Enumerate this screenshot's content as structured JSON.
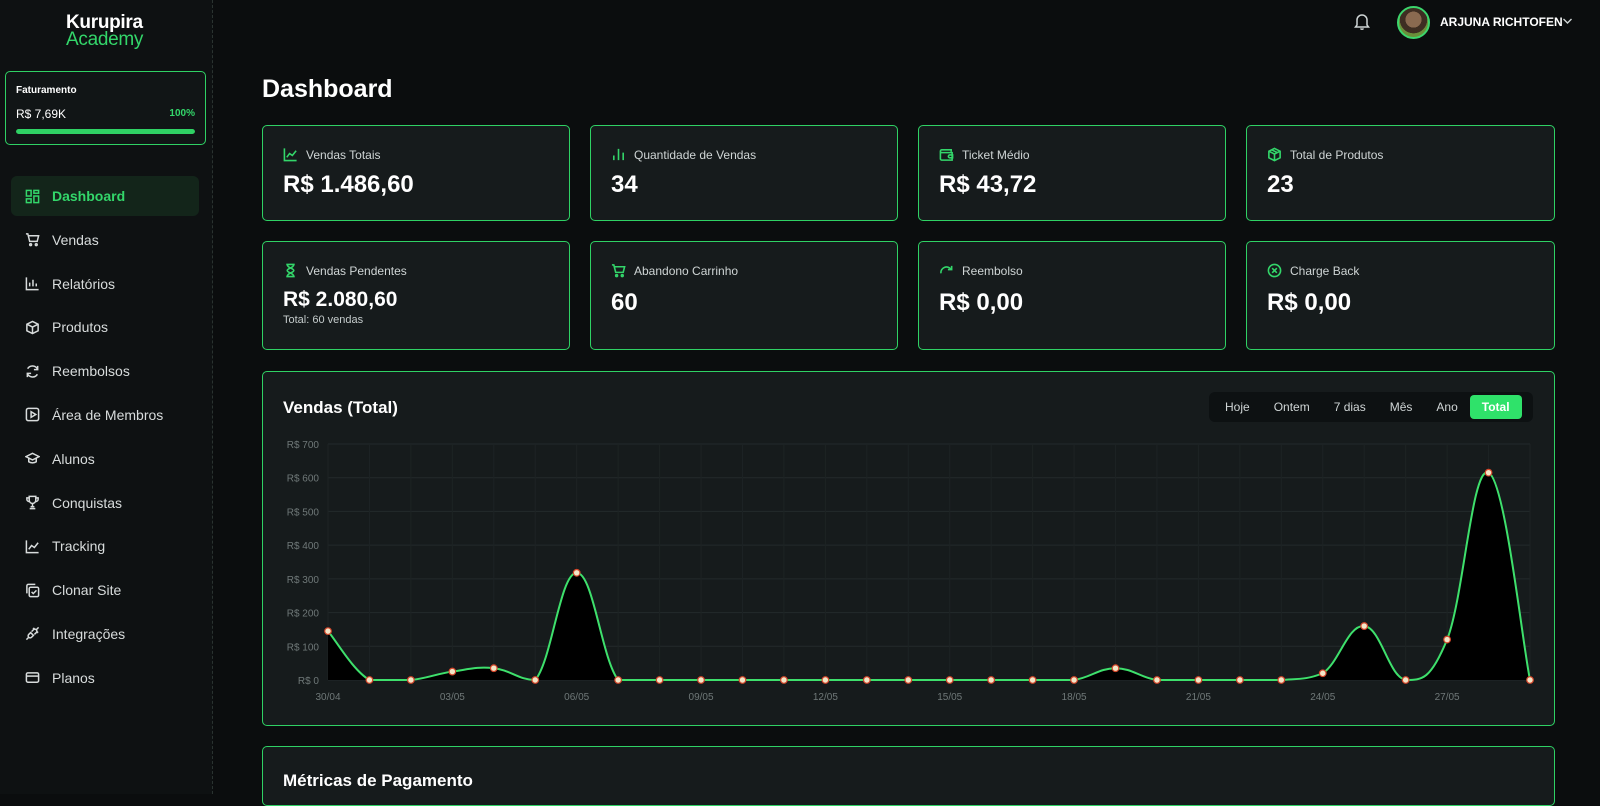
{
  "brand": {
    "line1": "Kurupira",
    "line2": "Academy"
  },
  "faturamento": {
    "title": "Faturamento",
    "value": "R$ 7,69K",
    "percent_label": "100%",
    "progress": 1.0
  },
  "sidebar": {
    "items": [
      {
        "label": "Dashboard",
        "icon": "dashboard-icon",
        "active": true
      },
      {
        "label": "Vendas",
        "icon": "cart-icon"
      },
      {
        "label": "Relatórios",
        "icon": "bar-chart-icon"
      },
      {
        "label": "Produtos",
        "icon": "box-icon"
      },
      {
        "label": "Reembolsos",
        "icon": "refresh-icon"
      },
      {
        "label": "Área de Membros",
        "icon": "play-square-icon"
      },
      {
        "label": "Alunos",
        "icon": "graduation-cap-icon"
      },
      {
        "label": "Conquistas",
        "icon": "trophy-icon"
      },
      {
        "label": "Tracking",
        "icon": "line-chart-icon"
      },
      {
        "label": "Clonar Site",
        "icon": "copy-check-icon"
      },
      {
        "label": "Integrações",
        "icon": "plug-icon"
      },
      {
        "label": "Planos",
        "icon": "credit-card-icon"
      }
    ]
  },
  "header": {
    "user_name": "ARJUNA RICHTOFEN",
    "notification_icon": "bell-icon"
  },
  "page": {
    "title": "Dashboard"
  },
  "stats": [
    {
      "label": "Vendas Totais",
      "value": "R$ 1.486,60",
      "icon": "trend-icon"
    },
    {
      "label": "Quantidade de Vendas",
      "value": "34",
      "icon": "bars-icon"
    },
    {
      "label": "Ticket Médio",
      "value": "R$ 43,72",
      "icon": "wallet-icon"
    },
    {
      "label": "Total de Produtos",
      "value": "23",
      "icon": "package-icon"
    },
    {
      "label": "Vendas Pendentes",
      "value": "R$ 2.080,60",
      "sub": "Total: 60 vendas",
      "icon": "hourglass-icon"
    },
    {
      "label": "Abandono Carrinho",
      "value": "60",
      "icon": "cart-icon"
    },
    {
      "label": "Reembolso",
      "value": "R$ 0,00",
      "icon": "redo-icon"
    },
    {
      "label": "Charge Back",
      "value": "R$ 0,00",
      "icon": "x-circle-icon"
    }
  ],
  "chart_section": {
    "title": "Vendas (Total)",
    "tabs": [
      "Hoje",
      "Ontem",
      "7 dias",
      "Mês",
      "Ano",
      "Total"
    ],
    "active_tab": "Total"
  },
  "next_section": {
    "title": "Métricas de Pagamento"
  },
  "colors": {
    "accent": "#2fd164",
    "background": "#0b0d0e",
    "card": "#161b1c"
  },
  "chart_data": {
    "type": "area",
    "x": [
      "30/04",
      "01/05",
      "02/05",
      "03/05",
      "04/05",
      "05/05",
      "06/05",
      "07/05",
      "08/05",
      "09/05",
      "10/05",
      "11/05",
      "12/05",
      "13/05",
      "14/05",
      "15/05",
      "16/05",
      "17/05",
      "18/05",
      "19/05",
      "20/05",
      "21/05",
      "22/05",
      "23/05",
      "24/05",
      "25/05",
      "26/05",
      "27/05",
      "28/05",
      "29/05"
    ],
    "x_tick_labels": [
      "30/04",
      "03/05",
      "06/05",
      "09/05",
      "12/05",
      "15/05",
      "18/05",
      "21/05",
      "24/05",
      "27/05"
    ],
    "values": [
      145,
      0,
      0,
      25,
      35,
      0,
      318,
      0,
      0,
      0,
      0,
      0,
      0,
      0,
      0,
      0,
      0,
      0,
      0,
      35,
      0,
      0,
      0,
      0,
      20,
      160,
      0,
      120,
      615,
      0
    ],
    "y_ticks": [
      "R$ 0",
      "R$ 100",
      "R$ 200",
      "R$ 300",
      "R$ 400",
      "R$ 500",
      "R$ 600",
      "R$ 700"
    ],
    "ylim": [
      0,
      700
    ],
    "grid": true,
    "line_color": "#3ee06c"
  }
}
